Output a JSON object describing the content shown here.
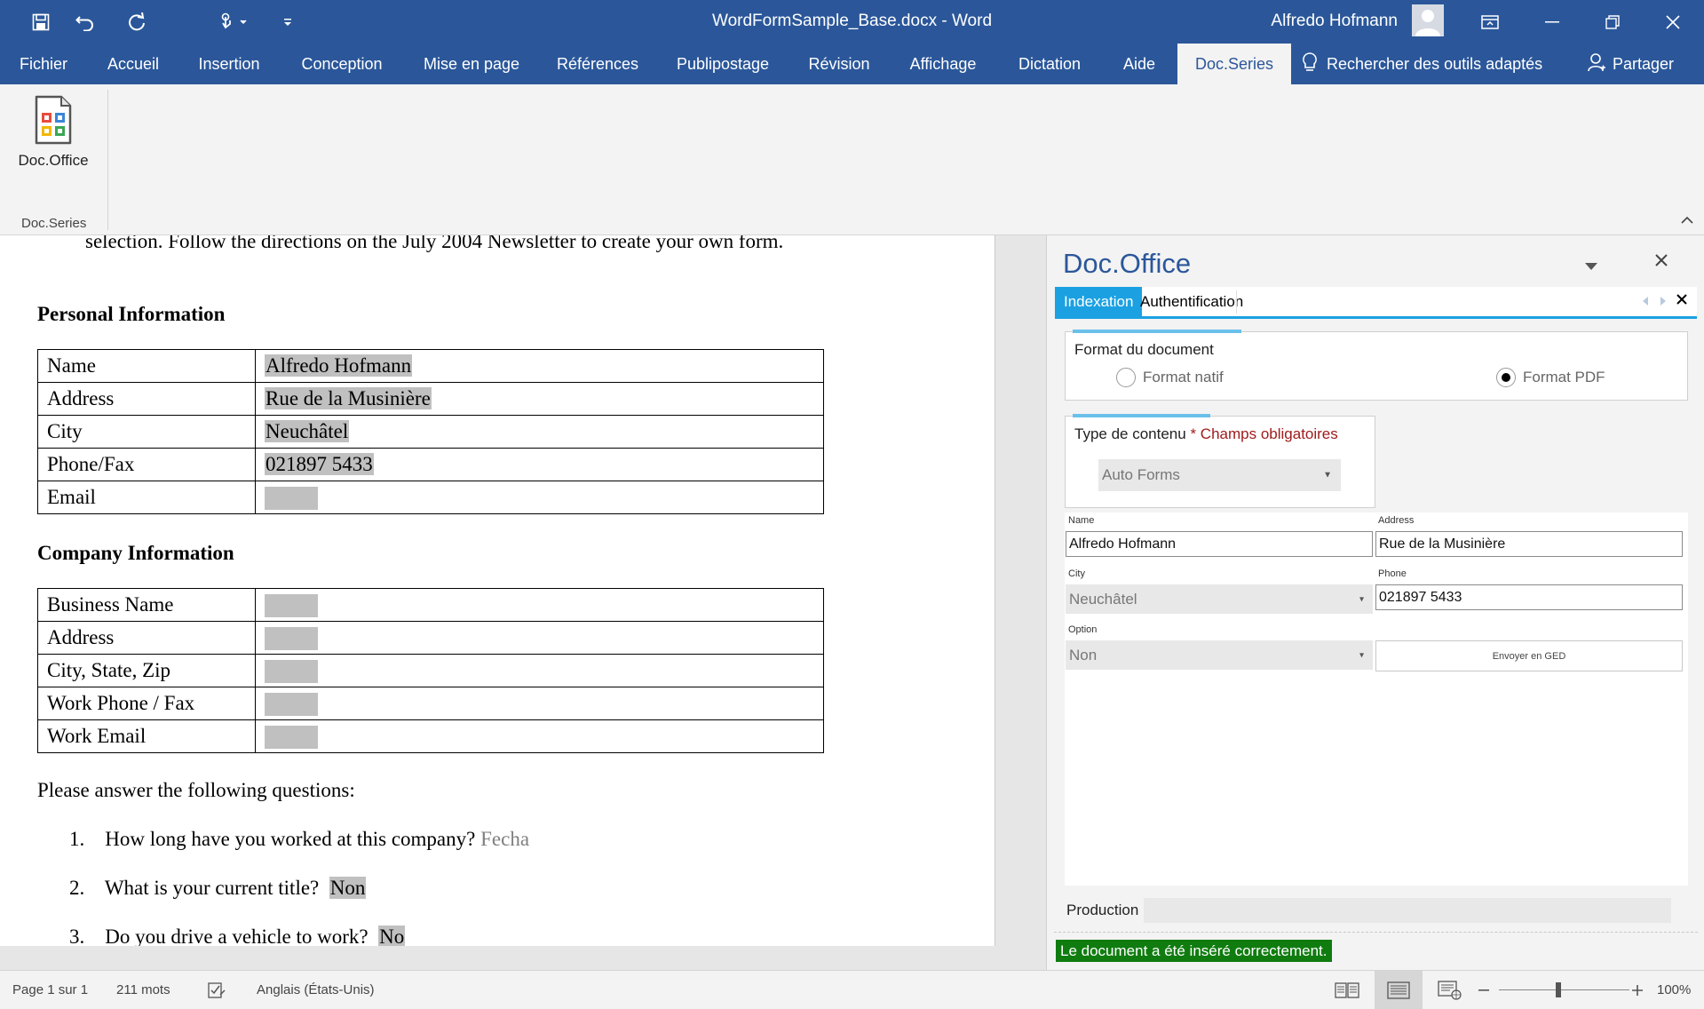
{
  "window": {
    "title": "WordFormSample_Base.docx  -  Word",
    "user_name": "Alfredo Hofmann"
  },
  "ribbon_tabs": [
    "Fichier",
    "Accueil",
    "Insertion",
    "Conception",
    "Mise en page",
    "Références",
    "Publipostage",
    "Révision",
    "Affichage",
    "Dictation",
    "Aide",
    "Doc.Series"
  ],
  "active_tab": "Doc.Series",
  "tell_me": "Rechercher des outils adaptés",
  "share": "Partager",
  "ribbon": {
    "button_label": "Doc.Office",
    "group_label": "Doc.Series"
  },
  "document": {
    "intro_tail": "selection.  Follow the directions on the July 2004 Newsletter to create your own form.",
    "personal_heading": "Personal Information",
    "personal_rows": [
      {
        "label": "Name",
        "value": "Alfredo Hofmann"
      },
      {
        "label": "Address",
        "value": "Rue de la Musinière"
      },
      {
        "label": "City",
        "value": "Neuchâtel"
      },
      {
        "label": "Phone/Fax",
        "value": "021897 5433"
      },
      {
        "label": "Email",
        "value": ""
      }
    ],
    "company_heading": "Company Information",
    "company_rows": [
      {
        "label": "Business Name",
        "value": ""
      },
      {
        "label": "Address",
        "value": ""
      },
      {
        "label": "City, State, Zip",
        "value": ""
      },
      {
        "label": "Work Phone / Fax",
        "value": ""
      },
      {
        "label": "Work Email",
        "value": ""
      }
    ],
    "questions_intro": "Please answer the following questions:",
    "questions": [
      {
        "num": "1.",
        "text": "How long have you worked at this company?",
        "answer": "Fecha"
      },
      {
        "num": "2.",
        "text": "What is your current title?",
        "answer": "Non"
      },
      {
        "num": "3.",
        "text": "Do you drive a vehicle to work?",
        "answer": "No"
      }
    ]
  },
  "pane": {
    "title": "Doc.Office",
    "tabs": [
      "Indexation",
      "Authentification"
    ],
    "format_group": {
      "title": "Format du document",
      "options": [
        "Format natif",
        "Format PDF"
      ],
      "selected": "Format PDF"
    },
    "content_group": {
      "title": "Type de contenu",
      "required_note": "* Champs obligatoires",
      "selected": "Auto Forms"
    },
    "fields": {
      "name_label": "Name",
      "name_value": "Alfredo Hofmann",
      "address_label": "Address",
      "address_value": "Rue de la Musinière",
      "city_label": "City",
      "city_value": "Neuchâtel",
      "phone_label": "Phone",
      "phone_value": "021897 5433",
      "option_label": "Option",
      "option_value": "Non",
      "send_button": "Envoyer en GED"
    },
    "production_label": "Production",
    "status_message": "Le document a été inséré correctement."
  },
  "statusbar": {
    "page": "Page 1 sur 1",
    "words": "211 mots",
    "language": "Anglais (États-Unis)",
    "zoom": "100%"
  },
  "colors": {
    "brand_blue": "#2b579a",
    "pane_accent": "#1ba1e2",
    "success_green": "#107c10",
    "required_red": "#a01c1c"
  }
}
